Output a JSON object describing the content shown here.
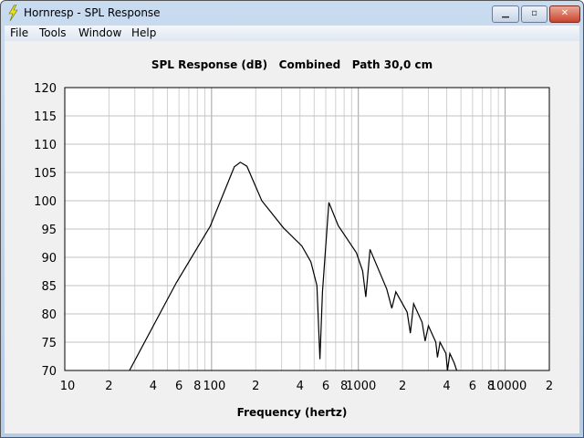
{
  "window": {
    "title": "Hornresp - SPL Response",
    "minimize": "▁",
    "maximize": "▫",
    "close": "✕"
  },
  "menu": [
    "File",
    "Tools",
    "Window",
    "Help"
  ],
  "chart_data": {
    "type": "line",
    "title": "SPL Response (dB)   Combined   Path 30,0 cm",
    "xlabel": "Frequency (hertz)",
    "ylabel": "",
    "xscale": "log",
    "xlim": [
      10,
      20000
    ],
    "ylim": [
      70,
      120
    ],
    "yticks": [
      70,
      75,
      80,
      85,
      90,
      95,
      100,
      105,
      110,
      115,
      120
    ],
    "xticks": [
      {
        "v": 10,
        "l": "10"
      },
      {
        "v": 20,
        "l": "2"
      },
      {
        "v": 40,
        "l": "4"
      },
      {
        "v": 60,
        "l": "6"
      },
      {
        "v": 80,
        "l": "8"
      },
      {
        "v": 100,
        "l": "100"
      },
      {
        "v": 200,
        "l": "2"
      },
      {
        "v": 400,
        "l": "4"
      },
      {
        "v": 600,
        "l": "6"
      },
      {
        "v": 800,
        "l": "8"
      },
      {
        "v": 1000,
        "l": "1000"
      },
      {
        "v": 2000,
        "l": "2"
      },
      {
        "v": 4000,
        "l": "4"
      },
      {
        "v": 6000,
        "l": "6"
      },
      {
        "v": 8000,
        "l": "8"
      },
      {
        "v": 10000,
        "l": "10000"
      },
      {
        "v": 20000,
        "l": "2"
      }
    ],
    "grid": true,
    "series": [
      {
        "name": "SPL",
        "color": "#000000",
        "x": [
          27.6,
          57.5,
          98,
          143,
          157,
          174,
          220,
          309,
          412,
          475,
          522,
          547,
          570,
          630,
          730,
          970,
          1070,
          1125,
          1200,
          1560,
          1690,
          1800,
          2150,
          2260,
          2380,
          2720,
          2850,
          3000,
          3370,
          3460,
          3600,
          3950,
          4050,
          4200,
          4500,
          4680
        ],
        "y": [
          70,
          85.5,
          95.5,
          106,
          106.8,
          106.1,
          100,
          95.2,
          92,
          89.2,
          85,
          72,
          83.9,
          99.7,
          95.6,
          90.8,
          87.6,
          83,
          91.4,
          84.4,
          81,
          83.9,
          80.3,
          76.6,
          81.8,
          78.5,
          75.2,
          77.9,
          75,
          72.3,
          75,
          73,
          70,
          73,
          71.3,
          70
        ]
      }
    ]
  }
}
